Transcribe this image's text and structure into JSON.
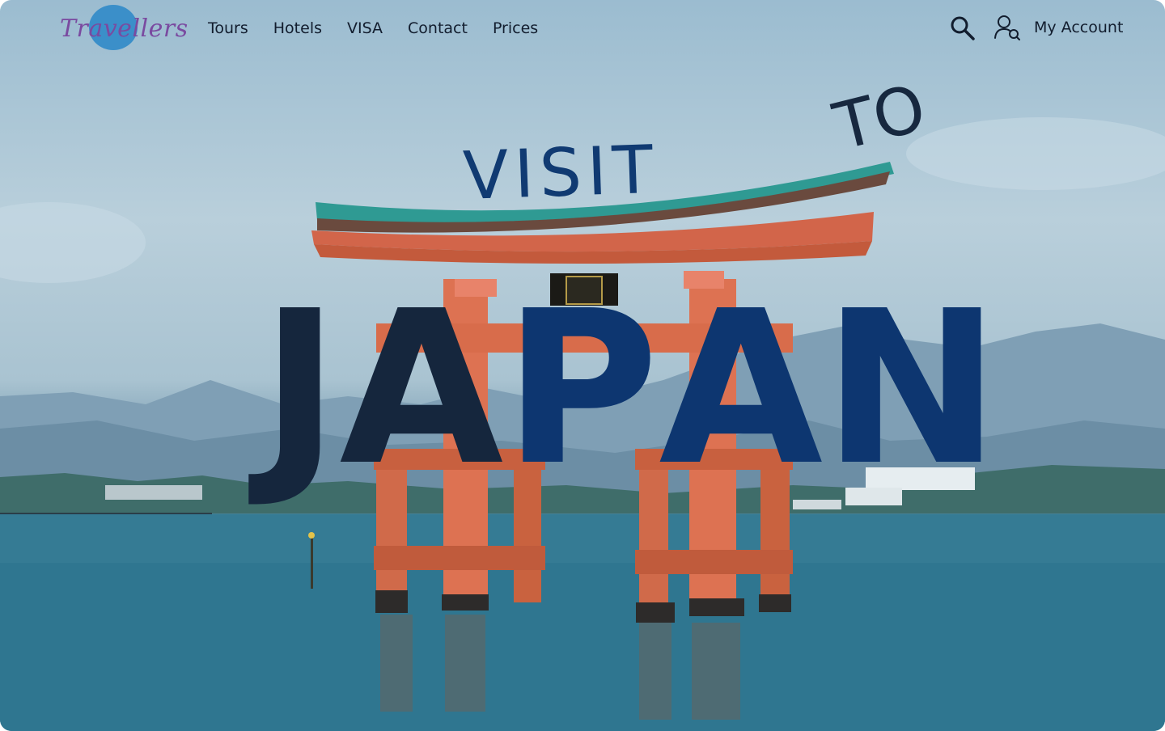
{
  "brand": {
    "name": "Travellers",
    "circle_color": "#3b8fc9",
    "text_color": "#7a4aa0"
  },
  "nav": {
    "items": [
      {
        "label": "Tours"
      },
      {
        "label": "Hotels"
      },
      {
        "label": "VISA"
      },
      {
        "label": "Contact"
      },
      {
        "label": "Prices"
      }
    ]
  },
  "header": {
    "search_icon": "search-icon",
    "account_icon": "user-search-icon",
    "account_label": "My Account"
  },
  "hero": {
    "line1": "VISIT",
    "line2": "TO",
    "headline_letters": [
      "J",
      "A",
      "P",
      "A",
      "N"
    ],
    "background": "torii gate in the sea at Miyajima, Japan",
    "colors": {
      "navy": "#0d3670",
      "dark": "#15263d",
      "torii": "#d9694a",
      "roof": "#2e9a93"
    }
  }
}
